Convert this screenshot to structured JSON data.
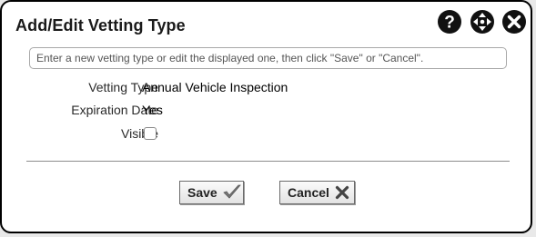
{
  "dialog": {
    "title": "Add/Edit Vetting Type",
    "icons": {
      "help": "question-circle-icon",
      "move": "move-arrows-icon",
      "close": "close-circle-icon"
    }
  },
  "instruction": {
    "text": "Enter a new vetting type or edit the displayed one, then click \"Save\" or \"Cancel\"."
  },
  "form": {
    "vetting_type_label": "Vetting Type",
    "vetting_type_value": "Annual Vehicle Inspection",
    "expiration_date_label": "Expiration Date",
    "expiration_date_value": "Yes",
    "visible_label": "Visible",
    "visible_checked": false
  },
  "buttons": {
    "save_label": "Save",
    "save_icon": "checkmark-icon",
    "cancel_label": "Cancel",
    "cancel_icon": "x-mark-icon"
  },
  "colors": {
    "border": "#000000",
    "background": "#ffffff",
    "icon_fill": "#111111"
  }
}
